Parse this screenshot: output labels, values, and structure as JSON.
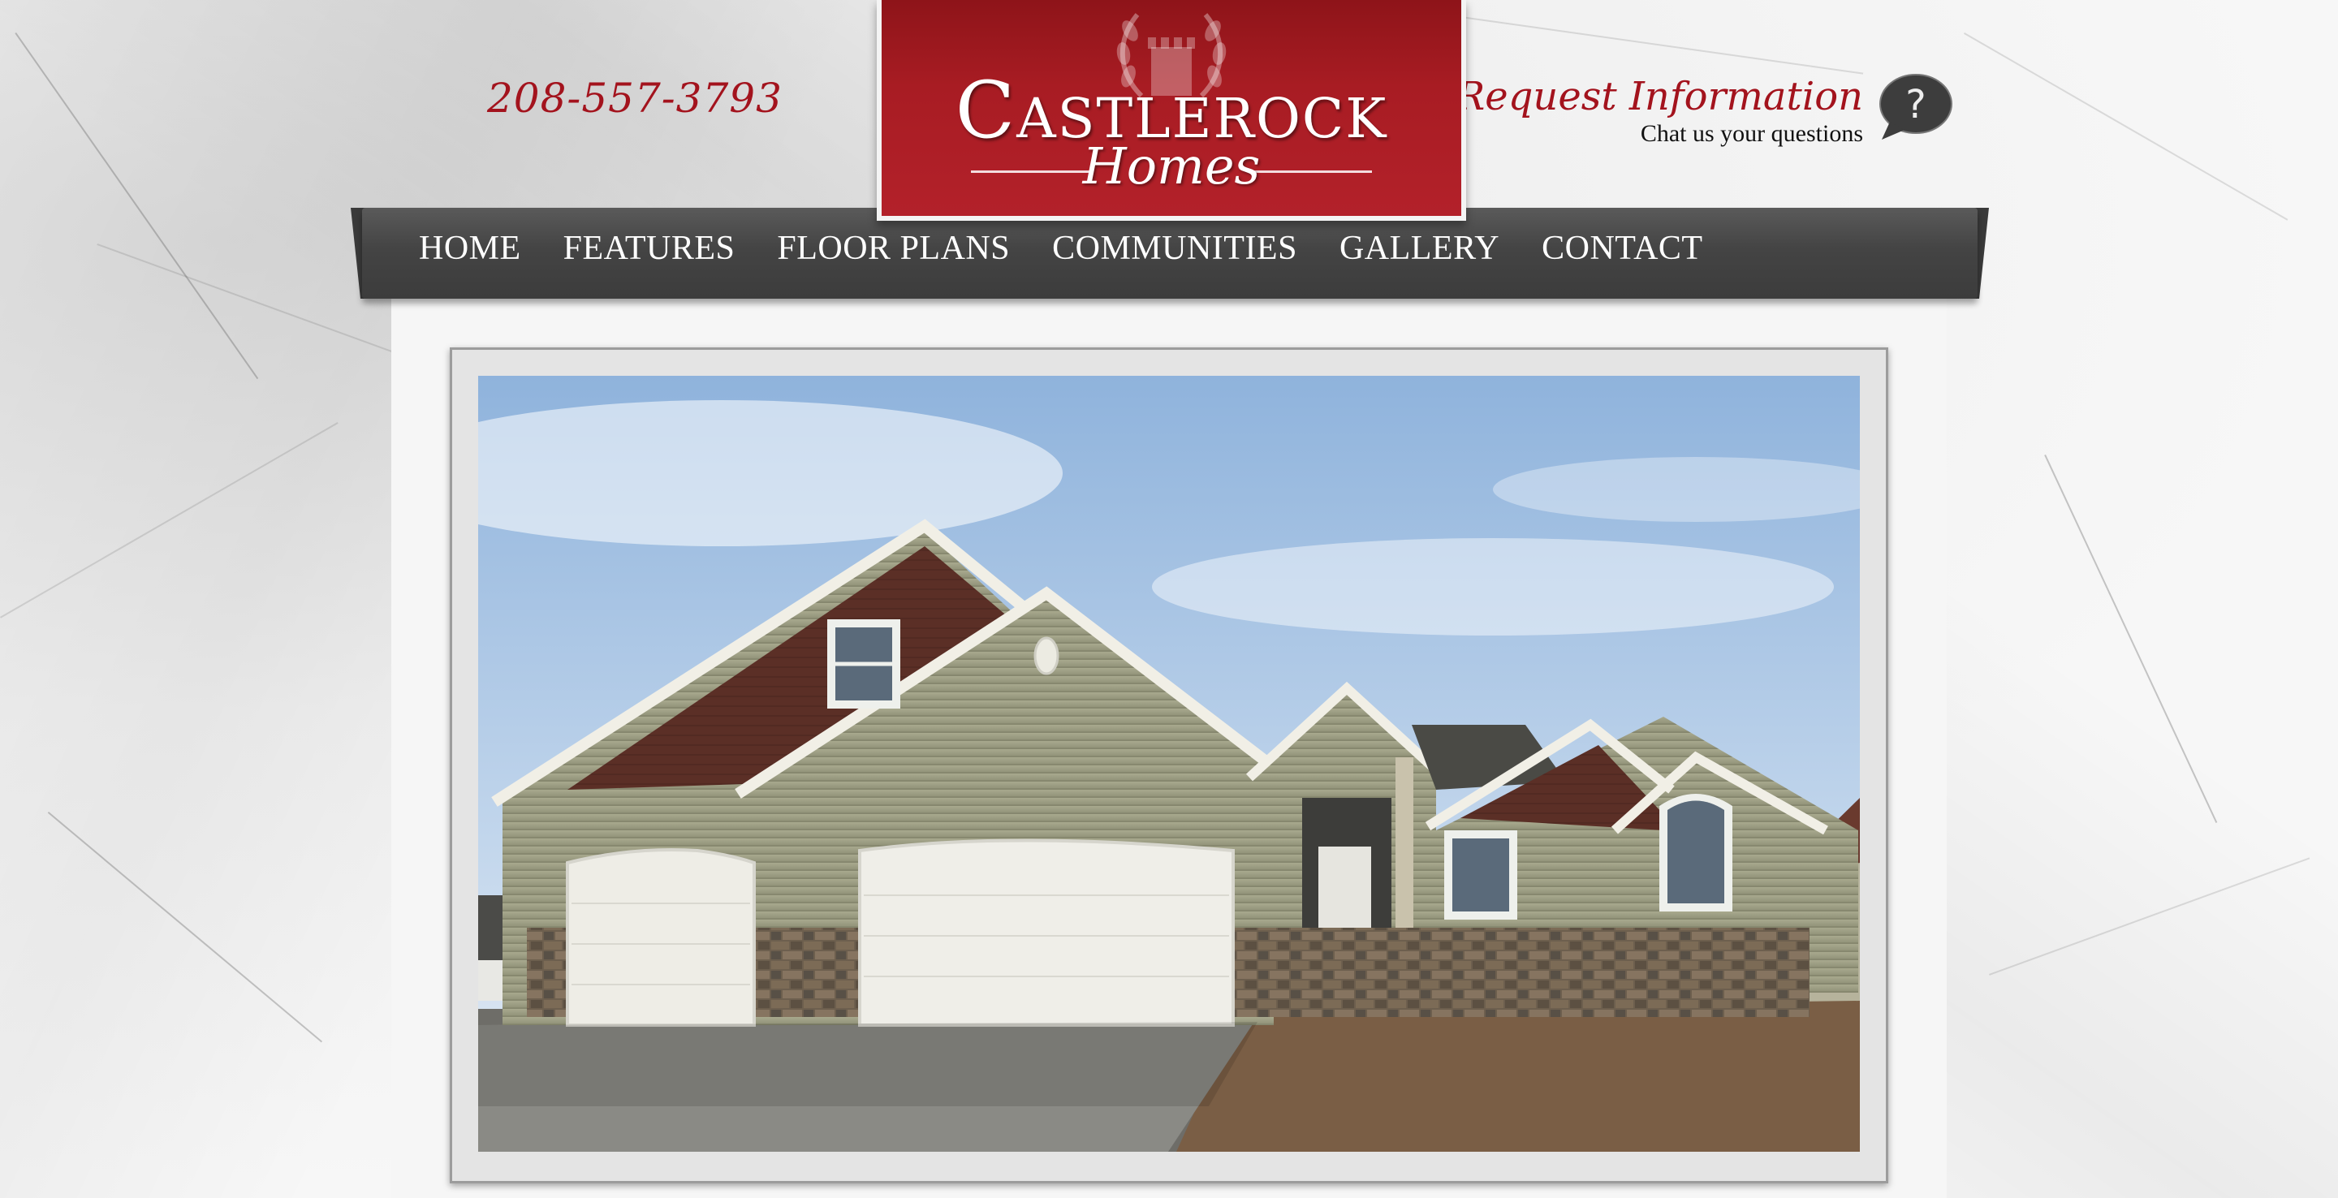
{
  "header": {
    "phone": "208-557-3793",
    "logo": {
      "brand": "Castlerock",
      "script": "Homes"
    },
    "request": {
      "title": "Request Information",
      "subtitle": "Chat us your questions",
      "icon": "question-bubble-icon"
    }
  },
  "nav": {
    "items": [
      "HOME",
      "FEATURES",
      "FLOOR PLANS",
      "COMMUNITIES",
      "GALLERY",
      "CONTACT"
    ]
  },
  "hero": {
    "image": "house-photo"
  },
  "colors": {
    "brand_red": "#a81c23",
    "nav_dark": "#444444",
    "background": "#f3f3f3"
  }
}
